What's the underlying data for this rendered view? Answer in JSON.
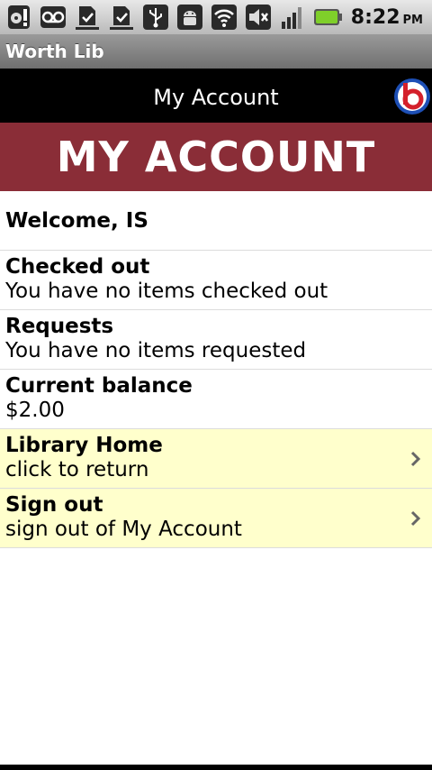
{
  "status_bar": {
    "icons": [
      "sd-card-icon",
      "voicemail-icon",
      "download-done-icon",
      "download-done-icon",
      "usb-icon",
      "android-debug-icon",
      "wifi-icon",
      "mute-icon",
      "signal-icon",
      "battery-icon"
    ],
    "time": "8:22",
    "ampm": "PM"
  },
  "app_title": "Worth Lib",
  "header": {
    "title": "My Account",
    "logo_icon": "b-logo-icon"
  },
  "banner": {
    "text": "MY ACCOUNT"
  },
  "colors": {
    "banner": "#8a2d37",
    "link_row": "#ffffcc",
    "header": "#000000"
  },
  "account": {
    "welcome": "Welcome, IS",
    "checked_out": {
      "title": "Checked out",
      "detail": "You have no items checked out"
    },
    "requests": {
      "title": "Requests",
      "detail": "You have no items requested"
    },
    "balance": {
      "title": "Current balance",
      "detail": "$2.00"
    },
    "library_home": {
      "title": "Library Home",
      "detail": "click to return"
    },
    "sign_out": {
      "title": "Sign out",
      "detail": "sign out of My Account"
    }
  }
}
